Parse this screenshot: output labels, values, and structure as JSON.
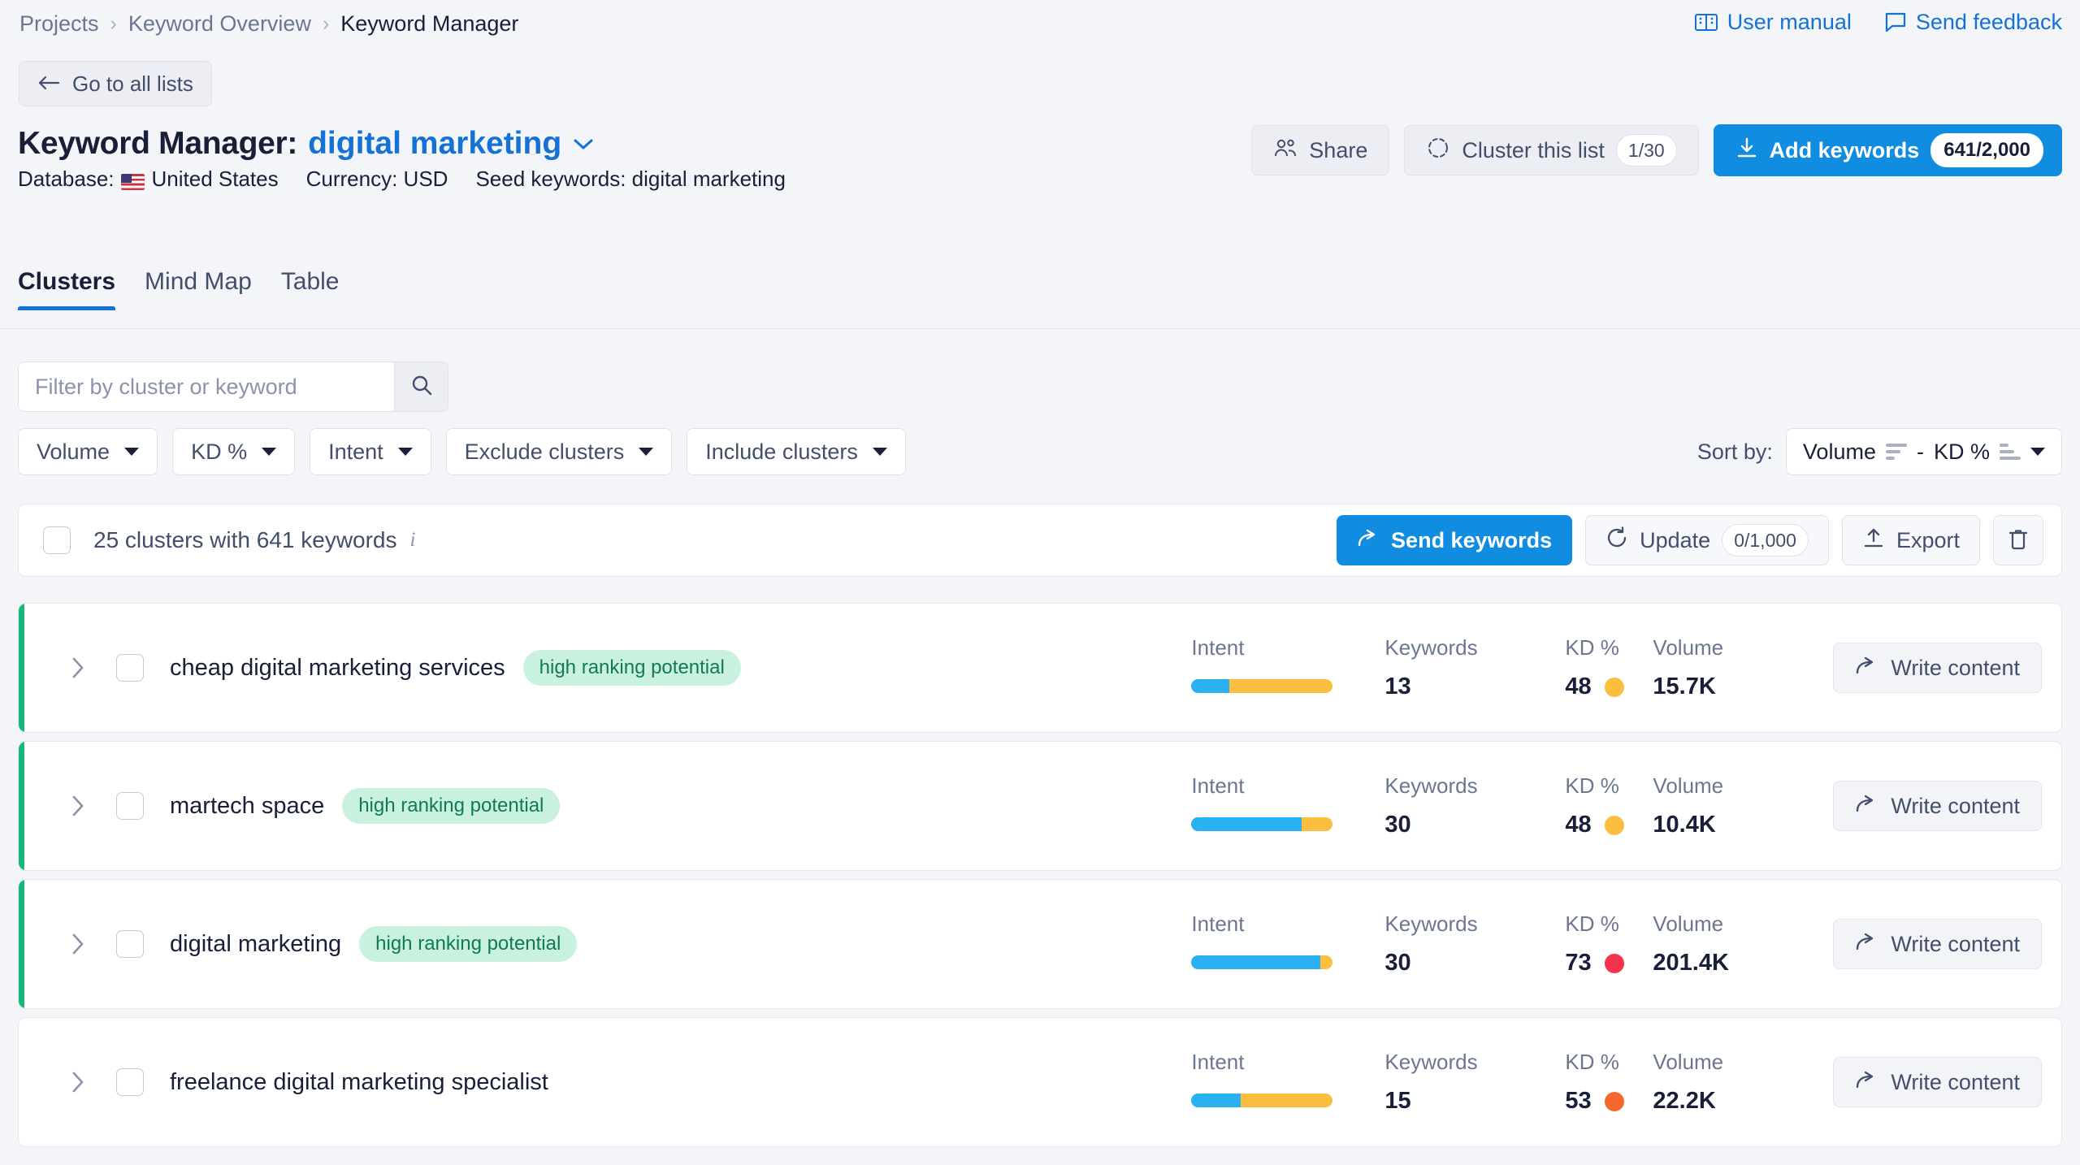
{
  "breadcrumb": {
    "items": [
      {
        "label": "Projects",
        "current": false
      },
      {
        "label": "Keyword Overview",
        "current": false
      },
      {
        "label": "Keyword Manager",
        "current": true
      }
    ],
    "separator": "›"
  },
  "top_links": {
    "user_manual": "User manual",
    "send_feedback": "Send feedback"
  },
  "back_button": "Go to all lists",
  "header": {
    "title_static": "Keyword Manager:",
    "title_keyword": "digital marketing",
    "database_label": "Database:",
    "database_value": "United States",
    "currency": "Currency: USD",
    "seed_keywords": "Seed keywords: digital marketing"
  },
  "header_actions": {
    "share": "Share",
    "cluster_this_list": "Cluster this list",
    "cluster_count": "1/30",
    "add_keywords": "Add keywords",
    "add_keywords_count": "641/2,000"
  },
  "tabs": [
    {
      "label": "Clusters",
      "active": true
    },
    {
      "label": "Mind Map",
      "active": false
    },
    {
      "label": "Table",
      "active": false
    }
  ],
  "filters": {
    "search_placeholder": "Filter by cluster or keyword",
    "search_value": "",
    "buttons": [
      "Volume",
      "KD %",
      "Intent",
      "Exclude clusters",
      "Include clusters"
    ],
    "sort_label": "Sort by:",
    "sort_value_1": "Volume",
    "sort_separator": "-",
    "sort_value_2": "KD %"
  },
  "toolbar": {
    "summary": "25 clusters with 641 keywords",
    "send_keywords": "Send keywords",
    "update": "Update",
    "update_count": "0/1,000",
    "export": "Export"
  },
  "columns": {
    "intent": "Intent",
    "keywords": "Keywords",
    "kd": "KD %",
    "volume": "Volume"
  },
  "write_content_label": "Write content",
  "badge_label": "high ranking potential",
  "colors": {
    "accent_blue": "#108de0",
    "link_blue": "#1472d6",
    "accent_green": "#17b978",
    "badge_bg": "#c8f2dd",
    "badge_text": "#117a54",
    "intent_informational": "#29b1f2",
    "intent_commercial": "#fbbe3e",
    "kd_easy": "#fbbe3e",
    "kd_difficult": "#f4682e",
    "kd_hard": "#f5334f"
  },
  "clusters": [
    {
      "name": "cheap digital marketing services",
      "badge": "high ranking potential",
      "has_accent": true,
      "intent_segments": [
        {
          "type": "informational",
          "pct": 27
        },
        {
          "type": "commercial",
          "pct": 73
        }
      ],
      "keywords": "13",
      "kd": "48",
      "kd_color": "#fbbe3e",
      "volume": "15.7K"
    },
    {
      "name": "martech space",
      "badge": "high ranking potential",
      "has_accent": true,
      "intent_segments": [
        {
          "type": "informational",
          "pct": 78
        },
        {
          "type": "commercial",
          "pct": 22
        }
      ],
      "keywords": "30",
      "kd": "48",
      "kd_color": "#fbbe3e",
      "volume": "10.4K"
    },
    {
      "name": "digital marketing",
      "badge": "high ranking potential",
      "has_accent": true,
      "intent_segments": [
        {
          "type": "informational",
          "pct": 91
        },
        {
          "type": "commercial",
          "pct": 9
        }
      ],
      "keywords": "30",
      "kd": "73",
      "kd_color": "#f5334f",
      "volume": "201.4K"
    },
    {
      "name": "freelance digital marketing specialist",
      "badge": "",
      "has_accent": false,
      "intent_segments": [
        {
          "type": "informational",
          "pct": 35
        },
        {
          "type": "commercial",
          "pct": 65
        }
      ],
      "keywords": "15",
      "kd": "53",
      "kd_color": "#f4682e",
      "volume": "22.2K"
    }
  ]
}
